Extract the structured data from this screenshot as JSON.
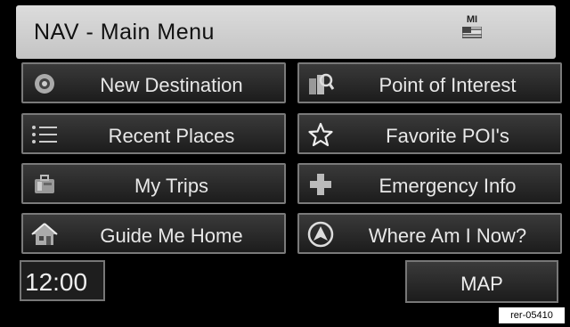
{
  "header": {
    "title": "NAV - Main Menu",
    "state": "MI"
  },
  "menu": [
    {
      "label": "New Destination",
      "icon": "new-destination-icon"
    },
    {
      "label": "Point of Interest",
      "icon": "point-of-interest-icon"
    },
    {
      "label": "Recent Places",
      "icon": "list-icon"
    },
    {
      "label": "Favorite POI's",
      "icon": "star-icon"
    },
    {
      "label": "My Trips",
      "icon": "suitcase-icon"
    },
    {
      "label": "Emergency Info",
      "icon": "cross-icon"
    },
    {
      "label": "Guide Me Home",
      "icon": "house-icon"
    },
    {
      "label": "Where Am I Now?",
      "icon": "compass-icon"
    }
  ],
  "footer": {
    "time": "12:00",
    "map_label": "MAP"
  },
  "reference_code": "rer-05410",
  "colors": {
    "button_bg": "#262626",
    "button_border": "#7a7a7a",
    "header_bg": "#d2d2d2",
    "text_light": "#e8e8e8"
  }
}
